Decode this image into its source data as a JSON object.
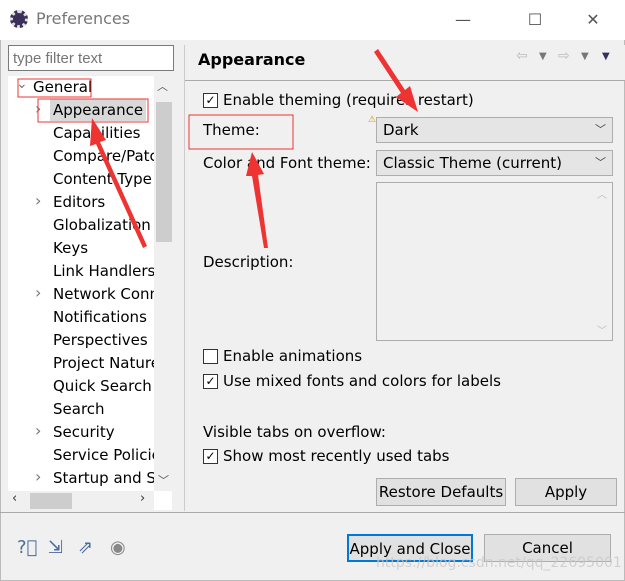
{
  "window": {
    "title": "Preferences",
    "minimize": "—",
    "maximize": "☐",
    "close": "✕"
  },
  "filter": {
    "placeholder": "type filter text"
  },
  "tree": [
    {
      "label": "General",
      "level": 0,
      "expand": "expanded"
    },
    {
      "label": "Appearance",
      "level": 1,
      "expand": "collapsed",
      "selected": true
    },
    {
      "label": "Capabilities",
      "level": 1
    },
    {
      "label": "Compare/Patc",
      "level": 1
    },
    {
      "label": "Content Type",
      "level": 1
    },
    {
      "label": "Editors",
      "level": 1,
      "expand": "collapsed"
    },
    {
      "label": "Globalization",
      "level": 1
    },
    {
      "label": "Keys",
      "level": 1
    },
    {
      "label": "Link Handlers",
      "level": 1
    },
    {
      "label": "Network Conn",
      "level": 1,
      "expand": "collapsed"
    },
    {
      "label": "Notifications",
      "level": 1
    },
    {
      "label": "Perspectives",
      "level": 1
    },
    {
      "label": "Project Nature",
      "level": 1
    },
    {
      "label": "Quick Search",
      "level": 1
    },
    {
      "label": "Search",
      "level": 1
    },
    {
      "label": "Security",
      "level": 1,
      "expand": "collapsed"
    },
    {
      "label": "Service Policie",
      "level": 1
    },
    {
      "label": "Startup and Sh",
      "level": 1,
      "expand": "collapsed"
    }
  ],
  "page": {
    "title": "Appearance",
    "enable_theming": {
      "label": "Enable theming (requires restart)",
      "checked": true
    },
    "theme_label": "Theme:",
    "theme_value": "Dark",
    "color_font_label": "Color and Font theme:",
    "color_font_value": "Classic Theme (current)",
    "description_label": "Description:",
    "enable_animations": {
      "label": "Enable animations",
      "checked": false
    },
    "mixed_fonts": {
      "label": "Use mixed fonts and colors for labels",
      "checked": true
    },
    "visible_tabs_label": "Visible tabs on overflow:",
    "recent_tabs": {
      "label": "Show most recently used tabs",
      "checked": true
    },
    "restore_defaults": "Restore Defaults",
    "apply": "Apply"
  },
  "footer": {
    "apply_close": "Apply and Close",
    "cancel": "Cancel",
    "icons": [
      "help-icon",
      "import-icon",
      "export-icon",
      "record-icon"
    ]
  },
  "watermark": "https://blog.csdn.net/qq_22695001",
  "colors": {
    "annotation": "#ee3333",
    "focus": "#0078d7"
  }
}
